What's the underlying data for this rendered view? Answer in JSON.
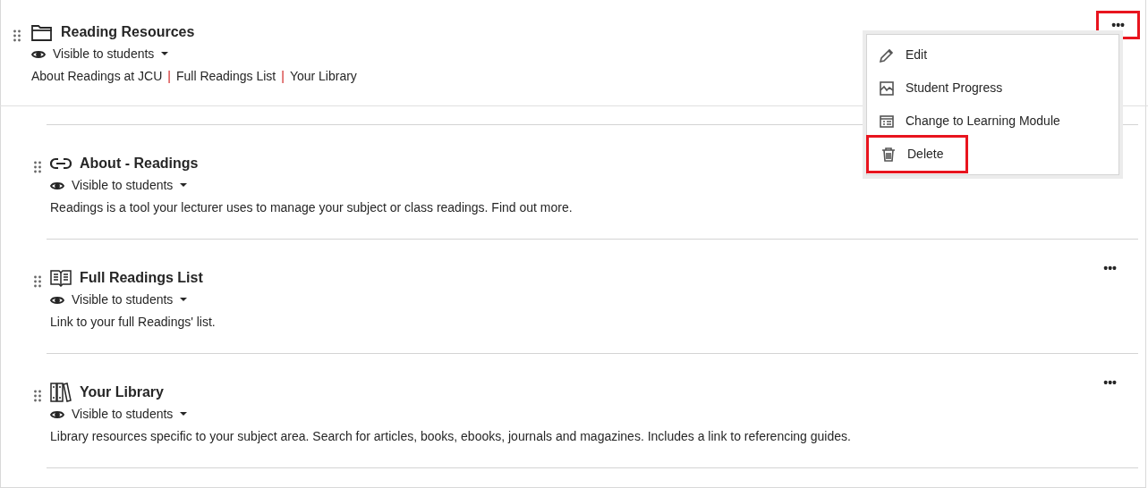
{
  "folder": {
    "title": "Reading Resources",
    "kind": "folder",
    "visibility": "Visible to students",
    "links": [
      "About Readings at JCU",
      "Full Readings List",
      "Your Library"
    ],
    "separator": "|",
    "more_button": {
      "label": "•••",
      "highlighted": true
    }
  },
  "items": [
    {
      "title": "About - Readings",
      "kind": "link",
      "visibility": "Visible to students",
      "description": "Readings is a tool your lecturer uses to manage your subject or class readings. Find out more."
    },
    {
      "title": "Full Readings List",
      "kind": "book",
      "visibility": "Visible to students",
      "description": "Link to your full Readings' list.",
      "more_button": {
        "label": "•••"
      }
    },
    {
      "title": "Your Library",
      "kind": "library",
      "visibility": "Visible to students",
      "description": "Library resources specific to your subject area. Search for articles, books, ebooks, journals and magazines. Includes a link to referencing guides.",
      "more_button": {
        "label": "•••"
      }
    }
  ],
  "menu": [
    {
      "label": "Edit",
      "kind": "edit",
      "highlighted": false
    },
    {
      "label": "Student Progress",
      "kind": "progress",
      "highlighted": false
    },
    {
      "label": "Change to Learning Module",
      "kind": "module",
      "highlighted": false
    },
    {
      "label": "Delete",
      "kind": "delete",
      "highlighted": true
    }
  ]
}
